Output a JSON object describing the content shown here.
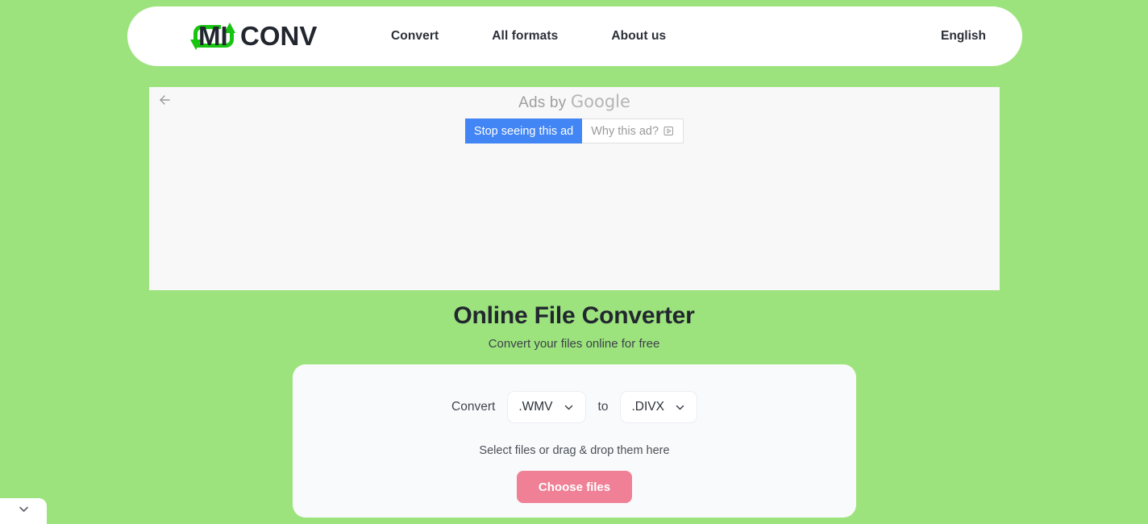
{
  "header": {
    "logo": {
      "text_left": "MI",
      "text_right": "CONV",
      "name": "miconv-logo",
      "arrow_color": "#17c411",
      "text_color": "#22262e"
    },
    "nav": [
      {
        "label": "Convert",
        "name": "nav-convert"
      },
      {
        "label": "All formats",
        "name": "nav-all-formats"
      },
      {
        "label": "About us",
        "name": "nav-about-us"
      }
    ],
    "language": "English"
  },
  "ad": {
    "back_icon": "arrow-left-icon",
    "ads_by_prefix": "Ads by ",
    "ads_by_brand": "Google",
    "stop_button": "Stop seeing this ad",
    "why_button": "Why this ad?",
    "why_icon": "play-triangle-icon",
    "stop_button_color": "#4285f4"
  },
  "hero": {
    "title": "Online File Converter",
    "subtitle": "Convert your files online for free"
  },
  "converter": {
    "convert_label": "Convert",
    "to_label": "to",
    "source_format": ".WMV",
    "target_format": ".DIVX",
    "chevron_icon": "chevron-down-icon",
    "drop_text": "Select files or drag & drop them here",
    "choose_button": "Choose files",
    "choose_button_color": "#ef8096"
  },
  "bottom_tab": {
    "icon": "chevron-down-icon"
  },
  "theme": {
    "page_background": "#9ce37d",
    "card_background": "#f9fafb",
    "ad_background": "#f8f8f8"
  }
}
